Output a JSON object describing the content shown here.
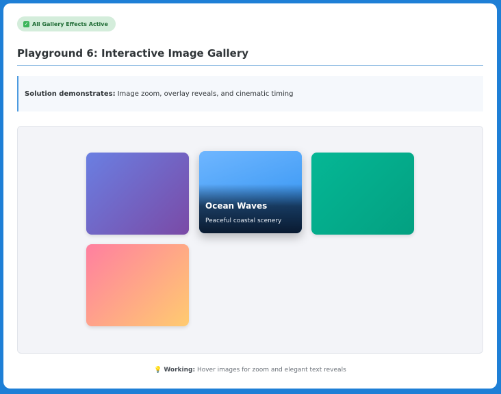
{
  "badge": {
    "icon": "check-icon",
    "label": "All Gallery Effects Active"
  },
  "header": {
    "title": "Playground 6: Interactive Image Gallery"
  },
  "note": {
    "bold": "Solution demonstrates:",
    "text": "Image zoom, overlay reveals, and cinematic timing"
  },
  "gallery": {
    "items": [
      {
        "colors": [
          "#6a7fe2",
          "#7a4aa6"
        ]
      },
      {
        "colors": [
          "#6fb6ff",
          "#2a8ff0"
        ],
        "title": "Ocean Waves",
        "subtitle": "Peaceful coastal scenery"
      },
      {
        "colors": [
          "#05b795",
          "#03a081"
        ]
      },
      {
        "colors": [
          "#ff7fa0",
          "#ffcb70"
        ]
      }
    ]
  },
  "footer": {
    "icon": "lightbulb-icon",
    "bold": "Working:",
    "text": "Hover images for zoom and elegant text reveals"
  }
}
